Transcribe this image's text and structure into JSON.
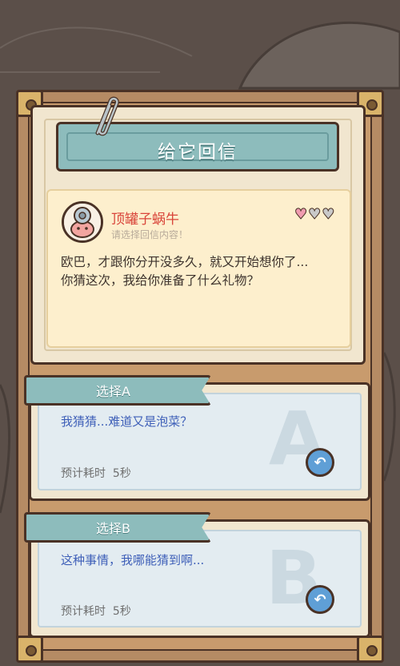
{
  "title": "给它回信",
  "letter": {
    "sender_name": "顶罐子蜗牛",
    "sender_sub": "请选择回信内容！",
    "hearts": {
      "filled": 1,
      "total": 3
    },
    "message_line1": "欧巴，才跟你分开没多久，就又开始想你了...",
    "message_line2": "你猜这次，我给你准备了什么礼物？"
  },
  "options": [
    {
      "tab_label": "选择A",
      "text": "我猜猜...难道又是泡菜？",
      "time_label": "预计耗时",
      "time_value": "5秒",
      "watermark": "A"
    },
    {
      "tab_label": "选择B",
      "text": "这种事情，我哪能猜到啊...",
      "time_label": "预计耗时",
      "time_value": "5秒",
      "watermark": "B"
    }
  ],
  "colors": {
    "frame": "#b58b64",
    "paper": "#f1e6cf",
    "banner": "#8dbcbc",
    "accent_red": "#d9453a",
    "option_text": "#3e5fb8",
    "refresh_button": "#5f9fd6"
  },
  "icons": {
    "clip": "paperclip-icon",
    "heart": "heart-icon",
    "refresh": "refresh-icon"
  }
}
